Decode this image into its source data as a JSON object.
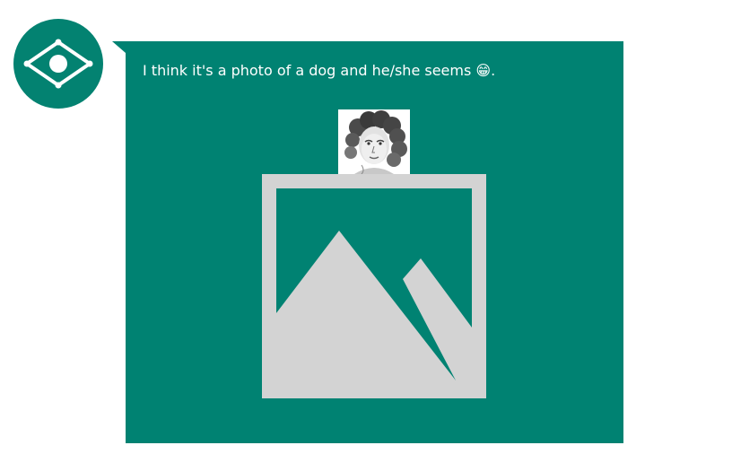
{
  "assistant": {
    "avatar_icon": "eye-icon"
  },
  "message": {
    "text": "I think it's a photo of a dog and he/she seems 😁.",
    "thumbnail_icon": "portrait-sketch-thumbnail",
    "placeholder_icon": "image-placeholder-icon"
  },
  "colors": {
    "bubble": "#008272",
    "avatar": "#038271",
    "placeholder": "#d3d3d3",
    "text": "#ffffff"
  }
}
